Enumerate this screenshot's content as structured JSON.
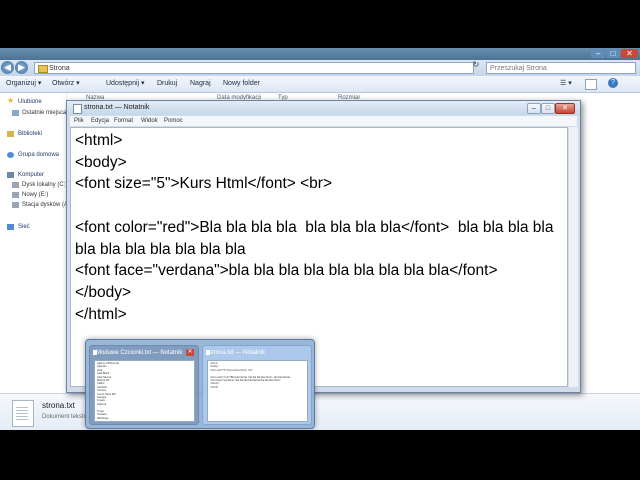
{
  "explorer": {
    "address_path": "Strona",
    "search_placeholder": "Przeszukaj Strona",
    "toolbar": {
      "organize": "Organizuj ▾",
      "open": "Otwórz ▾",
      "share": "Udostępnij ▾",
      "print": "Drukuj",
      "burn": "Nagraj",
      "new_folder": "Nowy folder"
    },
    "columns": [
      "Nazwa",
      "Data modyfikacji",
      "Typ",
      "Rozmiar"
    ],
    "nav": {
      "favorites": "Ulubione",
      "recent": "Ostatnie miejsca",
      "libraries": "Biblioteki",
      "homegroup": "Grupa domowa",
      "computer": "Komputer",
      "local_disk": "Dysk lokalny (C:)",
      "new_drive": "Nowy (E:)",
      "floppy": "Stacja dysków (A:)",
      "network": "Sieć"
    },
    "details": {
      "file_name": "strona.txt",
      "file_type": "Dokument tekstowy"
    }
  },
  "notepad": {
    "title": "strona.txt — Notatnik",
    "menu": [
      "Plik",
      "Edycja",
      "Format",
      "Widok",
      "Pomoc"
    ],
    "content_lines": [
      "<html>",
      "<body>",
      "<font size=\"5\">Kurs Html</font> <br>",
      "",
      "<font color=\"red\">Bla bla bla bla  bla bla bla bla</font>  bla bla bla bla",
      "bla bla bla bla bla bla bla",
      "<font face=\"verdana\">bla bla bla bla bla bla bla bla bla</font>",
      "</body>",
      "</html>"
    ]
  },
  "taskbar_thumbnails": [
    {
      "title": "Moduwe Czcionki.txt — Notatnik",
      "preview_lines": [
        "Agency FB Normal",
        "Algerian",
        "Arial",
        "Arial Black",
        "Arial Narrow",
        "Bodoni MT",
        "Calibri",
        "Cambria",
        "Century",
        "Comic Sans MS",
        "Georgia",
        "Impact",
        "Tahoma",
        "",
        "Times",
        "Verdana",
        "Webdings"
      ]
    },
    {
      "title": "strona.txt — Notatnik",
      "preview_lines": [
        "<html>",
        "<body>",
        "<font size=\"5\">Kurs Html</font> <br>",
        "",
        "<font color=\"red\">Bla bla bla bla  bla bla bla bla</font>  bla bla bla bla",
        "<font face=\"verdana\">bla bla bla bla bla bla bla bla bla</font>",
        "</body>",
        "</html>"
      ]
    }
  ],
  "colors": {
    "explorer_title": "#4c7393",
    "close_red": "#c8483a",
    "editor_text": "#000000"
  }
}
